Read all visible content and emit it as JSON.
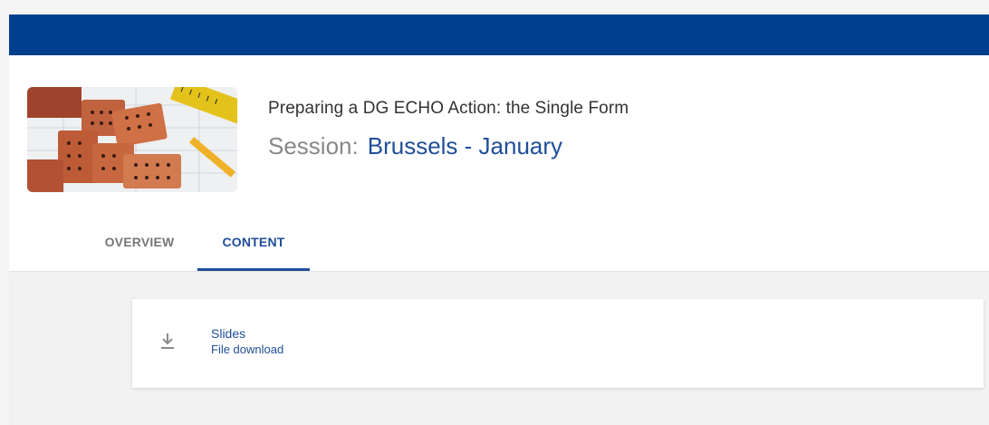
{
  "course": {
    "title": "Preparing a DG ECHO Action: the Single Form",
    "session_label": "Session:",
    "session_name": "Brussels - January"
  },
  "tabs": [
    {
      "label": "OVERVIEW",
      "active": false
    },
    {
      "label": "CONTENT",
      "active": true
    }
  ],
  "resources": [
    {
      "title": "Slides",
      "type": "File download",
      "icon": "download-icon"
    }
  ],
  "colors": {
    "topbar": "#003f8f",
    "accent": "#1f4e99",
    "muted": "#888888"
  }
}
